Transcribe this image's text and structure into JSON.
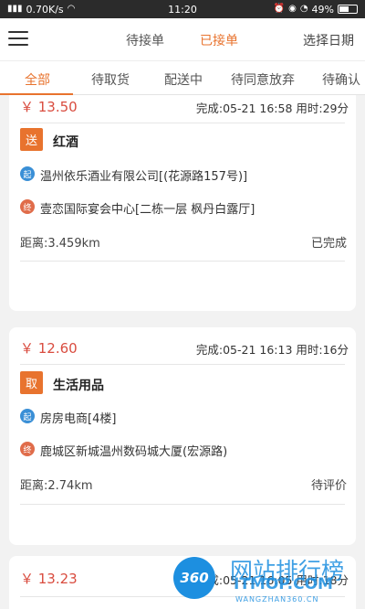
{
  "status_bar": {
    "network": "0.70K/s",
    "time": "11:20",
    "battery": "49%"
  },
  "header": {
    "tabs": [
      {
        "label": "待接单"
      },
      {
        "label": "已接单"
      }
    ],
    "active_tab": "已接单",
    "date_picker_label": "选择日期"
  },
  "subtabs": [
    {
      "label": "全部"
    },
    {
      "label": "待取货"
    },
    {
      "label": "配送中"
    },
    {
      "label": "待同意放弃"
    },
    {
      "label": "待确认"
    }
  ],
  "orders": [
    {
      "price": "￥ 13.50",
      "completed": "完成:05-21 16:58 用时:29分",
      "badge": "送",
      "category": "红酒",
      "start_marker": "起",
      "start_address": "温州依乐酒业有限公司[(花源路157号)]",
      "end_marker": "终",
      "end_address": "壹恋国际宴会中心[二栋一层 枫丹白露厅]",
      "distance": "距离:3.459km",
      "status": "已完成"
    },
    {
      "price": "￥ 12.60",
      "completed": "完成:05-21 16:13 用时:16分",
      "badge": "取",
      "category": "生活用品",
      "start_marker": "起",
      "start_address": "房房电商[4楼]",
      "end_marker": "终",
      "end_address": "鹿城区新城温州数码城大厦(宏源路)",
      "distance": "距离:2.74km",
      "status": "待评价"
    },
    {
      "price": "￥ 13.23",
      "completed": "完成:05-21 16:05 用时:18分"
    }
  ],
  "watermark": {
    "logo": "360",
    "title": "网站排行榜",
    "brand": "ITMOP.COM",
    "url": "WANGZHAN360.CN"
  },
  "colors": {
    "accent": "#e8732e",
    "price": "#d94c3f",
    "start_dot": "#3a8fd6",
    "end_dot": "#e06c4a"
  }
}
